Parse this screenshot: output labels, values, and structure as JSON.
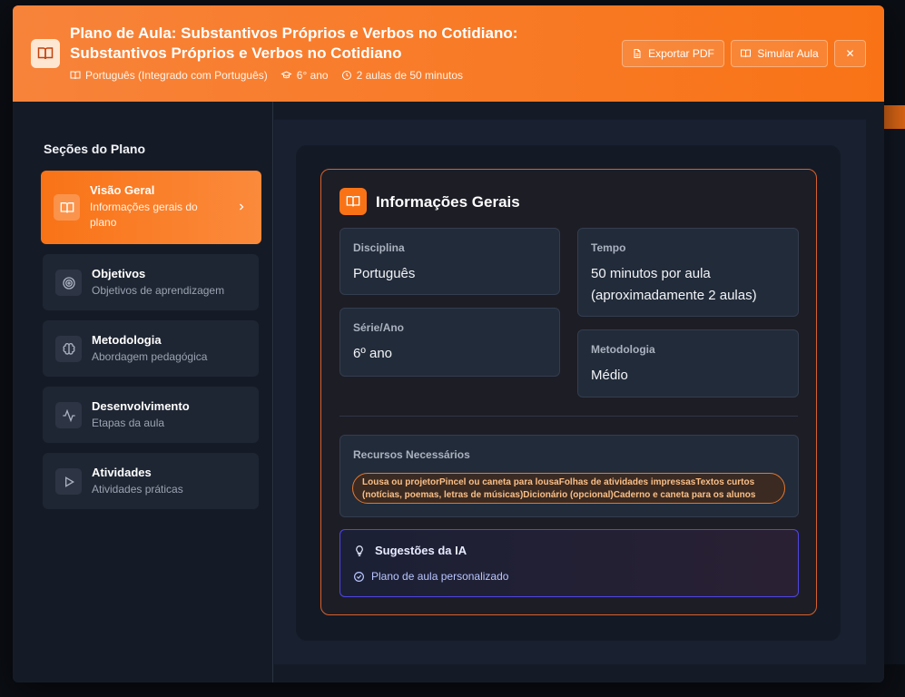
{
  "header": {
    "title": "Plano de Aula: Substantivos Próprios e Verbos no Cotidiano: Substantivos Próprios e Verbos no Cotidiano",
    "subject": "Português (Integrado com Português)",
    "grade": "6° ano",
    "duration": "2 aulas de 50 minutos",
    "export_label": "Exportar PDF",
    "simulate_label": "Simular Aula",
    "close_label": "✕"
  },
  "sidebar": {
    "title": "Seções do Plano",
    "items": [
      {
        "label": "Visão Geral",
        "sub": "Informações gerais do plano",
        "icon": "book-icon"
      },
      {
        "label": "Objetivos",
        "sub": "Objetivos de aprendizagem",
        "icon": "target-icon"
      },
      {
        "label": "Metodologia",
        "sub": "Abordagem pedagógica",
        "icon": "brain-icon"
      },
      {
        "label": "Desenvolvimento",
        "sub": "Etapas da aula",
        "icon": "activity-icon"
      },
      {
        "label": "Atividades",
        "sub": "Atividades práticas",
        "icon": "play-icon"
      }
    ]
  },
  "card": {
    "title": "Informações Gerais",
    "disciplina_label": "Disciplina",
    "disciplina_value": "Português",
    "serie_label": "Série/Ano",
    "serie_value": "6º ano",
    "tempo_label": "Tempo",
    "tempo_value": "50 minutos por aula (aproximadamente 2 aulas)",
    "metodologia_label": "Metodologia",
    "metodologia_value": "Médio",
    "resources_label": "Recursos Necessários",
    "resources_value": "Lousa ou projetorPincel ou caneta para lousaFolhas de atividades impressasTextos curtos (notícias, poemas, letras de músicas)Dicionário (opcional)Caderno e caneta para os alunos",
    "ai_title": "Sugestões da IA",
    "ai_item": "Plano de aula personalizado"
  },
  "colors": {
    "accent": "#f97316",
    "ai_border": "#4f46e5"
  }
}
